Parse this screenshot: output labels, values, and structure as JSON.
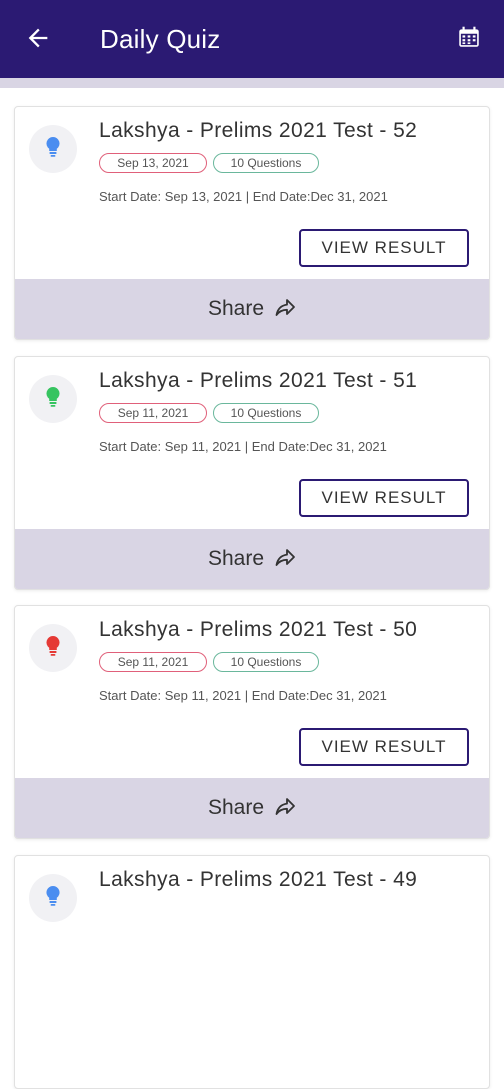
{
  "header": {
    "title": "Daily Quiz",
    "back_icon": "arrow-left-icon",
    "calendar_icon": "calendar-icon",
    "background": "#2b1a73"
  },
  "quizzes": [
    {
      "title": "Lakshya - Prelims 2021 Test - 52",
      "date_tag": "Sep 13, 2021",
      "questions_tag": "10 Questions",
      "dates_line": "Start Date: Sep 13, 2021 |  End Date:Dec 31, 2021",
      "button_label": "VIEW RESULT",
      "share_label": "Share",
      "bulb_color": "#4a8df0"
    },
    {
      "title": "Lakshya - Prelims 2021 Test - 51",
      "date_tag": "Sep 11, 2021",
      "questions_tag": "10 Questions",
      "dates_line": "Start Date: Sep 11, 2021 |  End Date:Dec 31, 2021",
      "button_label": "VIEW RESULT",
      "share_label": "Share",
      "bulb_color": "#36c460"
    },
    {
      "title": "Lakshya - Prelims 2021 Test - 50",
      "date_tag": "Sep 11, 2021",
      "questions_tag": "10 Questions",
      "dates_line": "Start Date: Sep 11, 2021 |  End Date:Dec 31, 2021",
      "button_label": "VIEW RESULT",
      "share_label": "Share",
      "bulb_color": "#e53935"
    },
    {
      "title": "Lakshya - Prelims 2021 Test - 49",
      "date_tag": "",
      "questions_tag": "",
      "dates_line": "",
      "button_label": "",
      "share_label": "",
      "bulb_color": "#4a8df0"
    }
  ]
}
